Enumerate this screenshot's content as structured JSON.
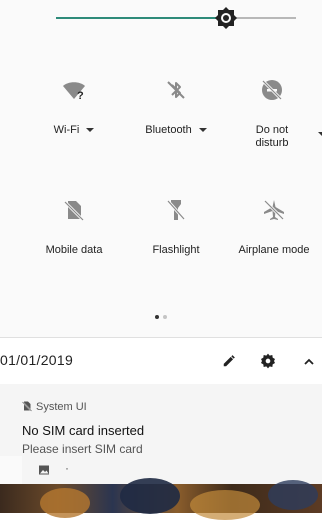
{
  "brightness": {
    "level": 0.71
  },
  "tiles": [
    {
      "label": "Wi-Fi",
      "icon": "wifi-unknown-icon",
      "has_menu": true
    },
    {
      "label": "Bluetooth",
      "icon": "bluetooth-off-icon",
      "has_menu": true
    },
    {
      "label": "Do not\ndisturb",
      "icon": "do-not-disturb-off-icon",
      "has_menu": true
    },
    {
      "label": "Mobile data",
      "icon": "no-sim-icon",
      "has_menu": false
    },
    {
      "label": "Flashlight",
      "icon": "flashlight-off-icon",
      "has_menu": false
    },
    {
      "label": "Airplane mode",
      "icon": "airplane-mode-off-icon",
      "has_menu": false
    }
  ],
  "pager": {
    "pages": 2,
    "current": 1
  },
  "footer": {
    "date": "01/01/2019",
    "icons": [
      "edit-icon",
      "settings-gear-icon",
      "collapse-chevron-up-icon"
    ]
  },
  "notification": {
    "app_name": "System UI",
    "icon": "no-sim-icon",
    "title": "No SIM card inserted",
    "body": "Please insert SIM card"
  },
  "notification_collapsed": {
    "icon": "image-icon",
    "separator": "·"
  },
  "colors": {
    "accent": "#2e8b7a",
    "icon_gray": "#8a8a8a",
    "text": "#222222"
  }
}
